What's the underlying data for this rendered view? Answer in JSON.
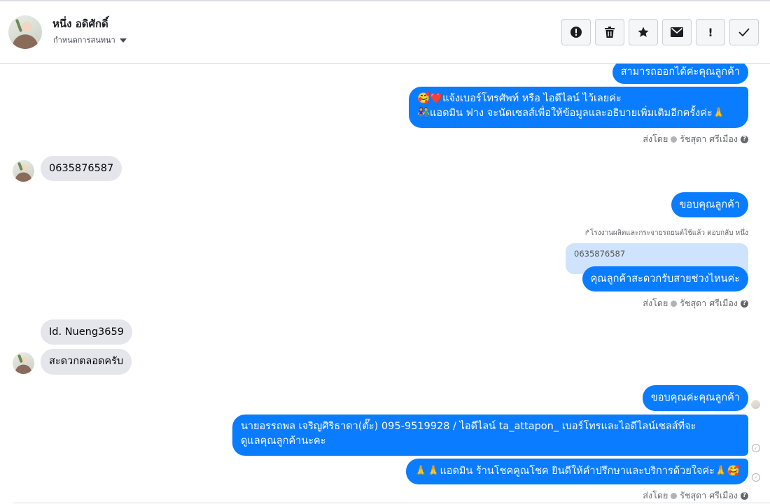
{
  "header": {
    "name": "หนึ่ง อดิศักดิ์",
    "subtitle": "กำหนดการสนทนา",
    "tools": [
      {
        "icon": "alert-circle-icon",
        "glyph": "!"
      },
      {
        "icon": "trash-icon",
        "glyph": "🗑"
      },
      {
        "icon": "star-icon",
        "glyph": "★"
      },
      {
        "icon": "envelope-icon",
        "glyph": "✉"
      },
      {
        "icon": "exclamation-icon",
        "glyph": "!"
      },
      {
        "icon": "check-icon",
        "glyph": "✓"
      }
    ]
  },
  "messages": {
    "m1": "สามารถออกได้ค่ะคุณลูกค้า",
    "m2_line1": "🥰❤️แจ้งเบอร์โทรศัพท์ หรือ ไอดีไลน์  ไว้เลยค่ะ",
    "m2_line2": "👫แอดมิน ฟาง จะนัดเซลส์เพื่อให้ข้อมูลและอธิบายเพิ่มเติมอีกครั้งค่ะ🙏",
    "sent_by_1": "ส่งโดย",
    "agent_1": "รัชสุดา ศรีเมือง",
    "m3": "0635876587",
    "m4": "ขอบคุณลูกค้า",
    "reply_note": "↱โรงงานผลิตและกระจายรถยนต์ใช้แล้ว ตอบกลับ หนึ่ง",
    "quoted": "0635876587",
    "m5": "คุณลูกค้าสะดวกรับสายช่วงไหนค่ะ",
    "sent_by_2": "ส่งโดย",
    "agent_2": "รัชสุดา ศรีเมือง",
    "m6": "Id.  Nueng3659",
    "m7": "สะดวกตลอดครับ",
    "m8": "ขอบคุณค่ะคุณลูกค้า",
    "m9_line1": "นายอรรถพล เจริญศิริธาดา(ตั๊ะ)      095-9519928 / ไอดีไลน์ ta_attapon_  เบอร์โทรและไอดีไลน์เซลส์ที่จะ",
    "m9_line2": "ดูแลคุณลูกค้านะคะ",
    "m10": "🙏🙏แอดมิน ร้านโชคคูณโชค ยินดีให้คำปรึกษาและบริการด้วยใจค่ะ🙏🥰",
    "sent_by_3": "ส่งโดย",
    "agent_3": "รัชสุดา ศรีเมือง"
  }
}
